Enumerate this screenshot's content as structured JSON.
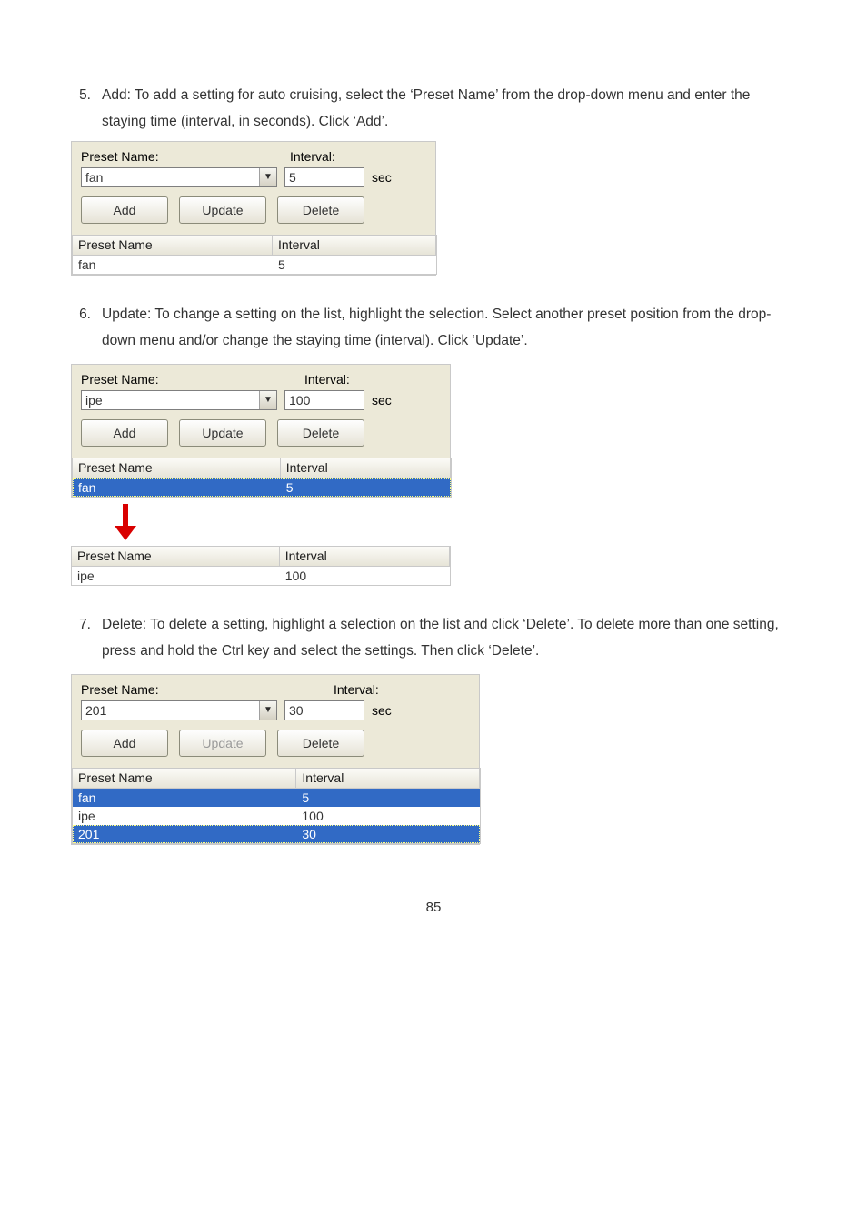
{
  "steps": {
    "s5": {
      "num": "5.",
      "text": "Add: To add a setting for auto cruising, select the ‘Preset Name’ from the drop-down menu and enter the staying time (interval, in seconds).   Click ‘Add’."
    },
    "s6": {
      "num": "6.",
      "text": "Update: To change a setting on the list, highlight the selection.   Select another preset position from the drop-down menu and/or change the staying time (interval).   Click ‘Update’."
    },
    "s7": {
      "num": "7.",
      "text": "Delete: To delete a setting, highlight a selection on the list and click ‘Delete’.   To delete more than one setting, press and hold the Ctrl key and select the settings.   Then click ‘Delete’."
    }
  },
  "labels": {
    "preset_name": "Preset Name:",
    "interval": "Interval:",
    "sec": "sec",
    "add": "Add",
    "update": "Update",
    "delete": "Delete",
    "col_preset": "Preset Name",
    "col_interval": "Interval"
  },
  "panel5": {
    "select_value": "fan",
    "interval_value": "5",
    "rows": [
      {
        "name": "fan",
        "interval": "5"
      }
    ]
  },
  "panel6a": {
    "select_value": "ipe",
    "interval_value": "100",
    "rows": [
      {
        "name": "fan",
        "interval": "5"
      }
    ]
  },
  "panel6b": {
    "rows": [
      {
        "name": "ipe",
        "interval": "100"
      }
    ]
  },
  "panel7": {
    "select_value": "201",
    "interval_value": "30",
    "rows": [
      {
        "name": "fan",
        "interval": "5"
      },
      {
        "name": "ipe",
        "interval": "100"
      },
      {
        "name": "201",
        "interval": "30"
      }
    ]
  },
  "page_number": "85"
}
